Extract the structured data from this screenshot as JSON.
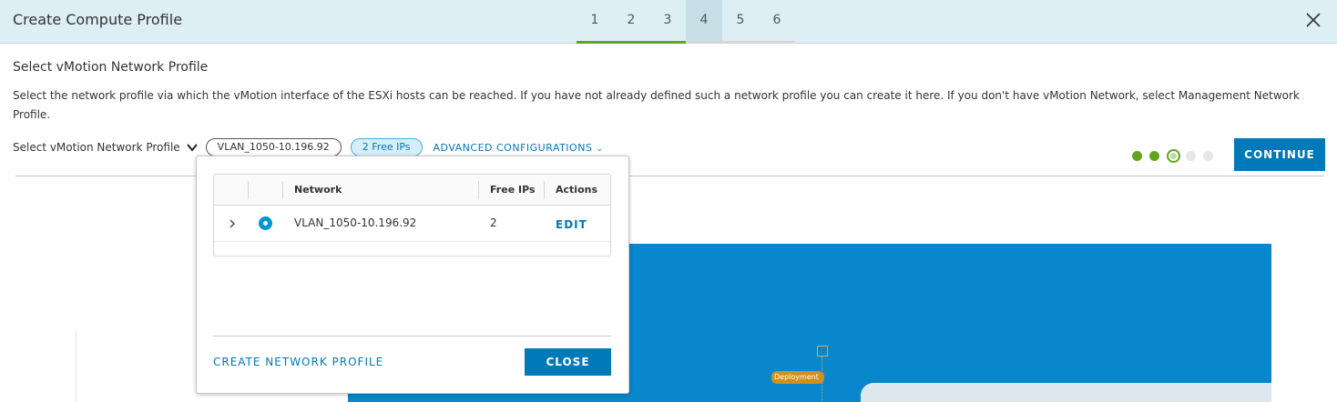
{
  "header": {
    "title": "Create Compute Profile",
    "steps": [
      "1",
      "2",
      "3",
      "4",
      "5",
      "6"
    ],
    "active_step": "4"
  },
  "section": {
    "title": "Select vMotion Network Profile",
    "description": "Select the network profile via which the vMotion interface of the ESXi hosts can be reached. If you have not already defined such a network profile you can create it here. If you don't have vMotion Network, select Management Network Profile."
  },
  "selector": {
    "label": "Select vMotion Network Profile",
    "selected_value": "VLAN_1050-10.196.92",
    "free_ips_badge": "2 Free IPs",
    "advanced_label": "ADVANCED CONFIGURATIONS"
  },
  "progress": {
    "total": 5,
    "completed": 2,
    "current_index": 3
  },
  "continue_label": "CONTINUE",
  "popover": {
    "columns": [
      "Network",
      "Free IPs",
      "Actions"
    ],
    "rows": [
      {
        "network": "VLAN_1050-10.196.92",
        "free_ips": "2",
        "action": "EDIT",
        "selected": true
      }
    ],
    "create_label": "CREATE NETWORK PROFILE",
    "close_label": "CLOSE"
  },
  "canvas": {
    "deployment_label": "Deployment"
  },
  "colors": {
    "header_bg": "#ddeef5",
    "primary": "#0079b8",
    "step_done": "#62a420",
    "canvas_blue": "#0887cc",
    "deployment_orange": "#d28f1a"
  },
  "icons": {
    "close": "close-icon",
    "caret": "chevron-down-icon",
    "row_expand": "chevron-right-icon",
    "radio": "radio-selected-icon"
  }
}
